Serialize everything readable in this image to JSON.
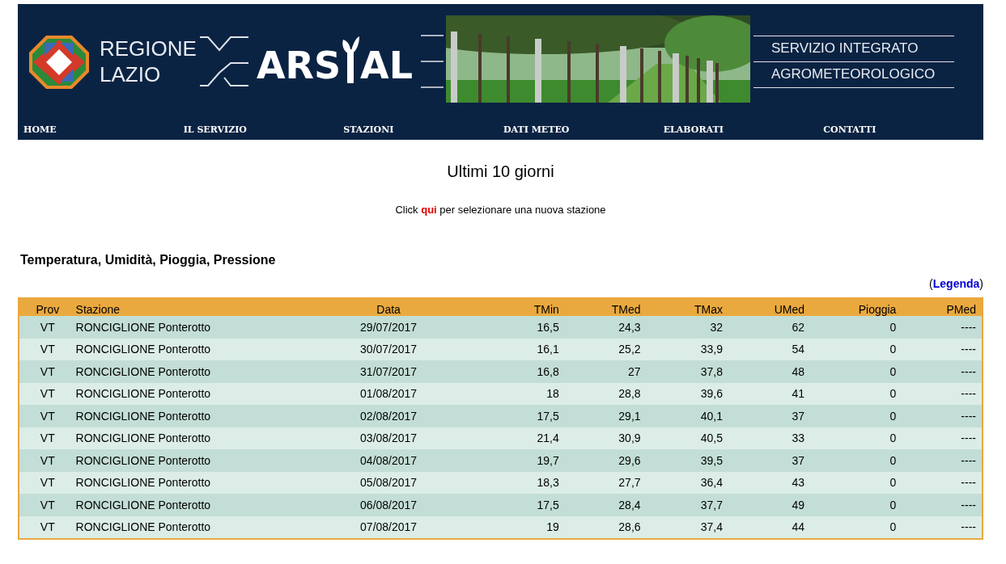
{
  "header": {
    "region_name": [
      "REGIONE",
      "LAZIO"
    ],
    "agency_name": [
      "ARS",
      "AL"
    ],
    "service_name": [
      "SERVIZIO INTEGRATO",
      "AGROMETEOROLOGICO"
    ]
  },
  "nav": [
    "HOME",
    "IL SERVIZIO",
    "STAZIONI",
    "DATI METEO",
    "ELABORATI",
    "CONTATTI"
  ],
  "title": "Ultimi 10 giorni",
  "instruction": {
    "before": "Click",
    "link": "qui",
    "after": "per selezionare una nuova stazione"
  },
  "section_title": "Temperatura, Umidità, Pioggia, Pressione",
  "legend": {
    "open": "(",
    "link": "Legenda",
    "close": ")"
  },
  "table": {
    "columns": [
      "Prov",
      "Stazione",
      "Data",
      "TMin",
      "TMed",
      "TMax",
      "UMed",
      "Pioggia",
      "PMed"
    ],
    "rows": [
      [
        "VT",
        "RONCIGLIONE Ponterotto",
        "29/07/2017",
        "16,5",
        "24,3",
        "32",
        "62",
        "0",
        "----"
      ],
      [
        "VT",
        "RONCIGLIONE Ponterotto",
        "30/07/2017",
        "16,1",
        "25,2",
        "33,9",
        "54",
        "0",
        "----"
      ],
      [
        "VT",
        "RONCIGLIONE Ponterotto",
        "31/07/2017",
        "16,8",
        "27",
        "37,8",
        "48",
        "0",
        "----"
      ],
      [
        "VT",
        "RONCIGLIONE Ponterotto",
        "01/08/2017",
        "18",
        "28,8",
        "39,6",
        "41",
        "0",
        "----"
      ],
      [
        "VT",
        "RONCIGLIONE Ponterotto",
        "02/08/2017",
        "17,5",
        "29,1",
        "40,1",
        "37",
        "0",
        "----"
      ],
      [
        "VT",
        "RONCIGLIONE Ponterotto",
        "03/08/2017",
        "21,4",
        "30,9",
        "40,5",
        "33",
        "0",
        "----"
      ],
      [
        "VT",
        "RONCIGLIONE Ponterotto",
        "04/08/2017",
        "19,7",
        "29,6",
        "39,5",
        "37",
        "0",
        "----"
      ],
      [
        "VT",
        "RONCIGLIONE Ponterotto",
        "05/08/2017",
        "18,3",
        "27,7",
        "36,4",
        "43",
        "0",
        "----"
      ],
      [
        "VT",
        "RONCIGLIONE Ponterotto",
        "06/08/2017",
        "17,5",
        "28,4",
        "37,7",
        "49",
        "0",
        "----"
      ],
      [
        "VT",
        "RONCIGLIONE Ponterotto",
        "07/08/2017",
        "19",
        "28,6",
        "37,4",
        "44",
        "0",
        "----"
      ]
    ]
  }
}
